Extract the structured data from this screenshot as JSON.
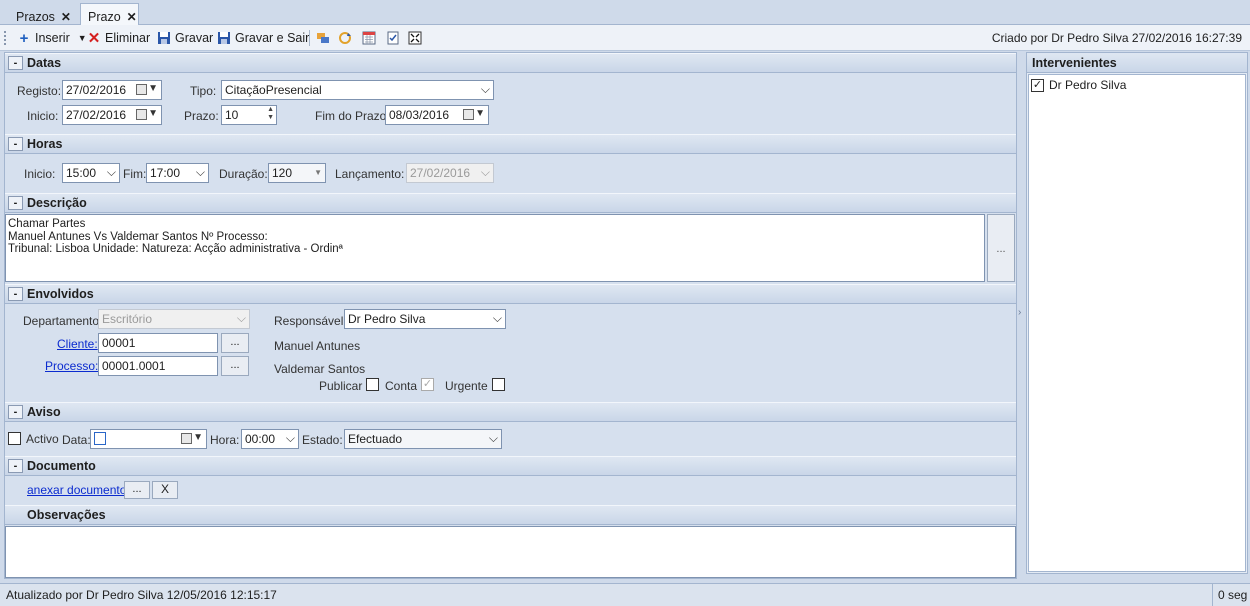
{
  "tabs": [
    {
      "label": "Prazos",
      "close": "✕"
    },
    {
      "label": "Prazo",
      "close": "✕"
    }
  ],
  "toolbar": {
    "insert": "Inserir",
    "delete": "Eliminar",
    "save": "Gravar",
    "save_exit": "Gravar e Sair",
    "created_by": "Criado por Dr Pedro Silva 27/02/2016 16:27:39"
  },
  "datas": {
    "title": "Datas",
    "registo_label": "Registo:",
    "registo": "27/02/2016",
    "tipo_label": "Tipo:",
    "tipo": "CitaçãoPresencial",
    "inicio_label": "Inicio:",
    "inicio": "27/02/2016",
    "prazo_label": "Prazo:",
    "prazo": "10",
    "fim_label": "Fim do Prazo:",
    "fim": "08/03/2016"
  },
  "horas": {
    "title": "Horas",
    "inicio_label": "Inicio:",
    "inicio": "15:00",
    "fim_label": "Fim:",
    "fim": "17:00",
    "duracao_label": "Duração:",
    "duracao": "120",
    "lancamento_label": "Lançamento:",
    "lancamento": "27/02/2016"
  },
  "descricao": {
    "title": "Descrição",
    "lines": [
      "Chamar Partes",
      "Manuel Antunes Vs Valdemar Santos Nº Processo:",
      "Tribunal: Lisboa Unidade:  Natureza: Acção administrativa - Ordinª"
    ],
    "more": "..."
  },
  "envolvidos": {
    "title": "Envolvidos",
    "departamento_label": "Departamento:",
    "departamento": "Escritório",
    "responsavel_label": "Responsável:",
    "responsavel": "Dr Pedro Silva",
    "cliente_label": "Cliente:",
    "cliente": "00001",
    "cliente_name": "Manuel Antunes",
    "processo_label": "Processo:",
    "processo": "00001.0001",
    "processo_name": "Valdemar Santos",
    "more": "...",
    "publicar_label": "Publicar",
    "conta_label": "Conta",
    "urgente_label": "Urgente"
  },
  "aviso": {
    "title": "Aviso",
    "activo_label": "Activo",
    "data_label": "Data:",
    "data": "",
    "hora_label": "Hora:",
    "hora": "00:00",
    "estado_label": "Estado:",
    "estado": "Efectuado"
  },
  "documento": {
    "title": "Documento",
    "link": "anexar documento",
    "more": "...",
    "remove": "X"
  },
  "observacoes": {
    "title": "Observações"
  },
  "intervenientes": {
    "title": "Intervenientes",
    "items": [
      "Dr Pedro Silva"
    ]
  },
  "status": {
    "updated": "Atualizado por Dr Pedro Silva 12/05/2016 12:15:17",
    "time": "0 seg"
  }
}
